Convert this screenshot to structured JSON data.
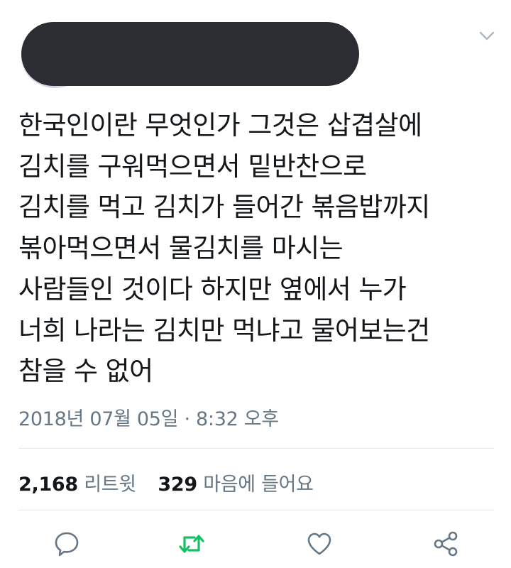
{
  "tweet": {
    "text": "한국인이란 무엇인가 그것은 삽겹살에\n김치를 구워먹으면서 밑반찬으로\n김치를 먹고 김치가 들어간 볶음밥까지\n볶아먹으면서 물김치를 마시는\n사람들인 것이다 하지만 옆에서 누가\n너희 나라는 김치만 먹냐고 물어보는건\n참을 수 없어",
    "timestamp": "2018년 07월 05일 · 8:32 오후"
  },
  "stats": {
    "retweets_count": "2,168",
    "retweets_label": "리트윗",
    "likes_count": "329",
    "likes_label": "마음에 들어요"
  },
  "colors": {
    "text": "#14171a",
    "secondary": "#657786",
    "retweet_active": "#17bf63",
    "divider": "#e1e8ed"
  },
  "icons": {
    "menu": "chevron-down-icon",
    "reply": "reply-icon",
    "retweet": "retweet-icon",
    "like": "heart-icon",
    "share": "share-icon"
  }
}
